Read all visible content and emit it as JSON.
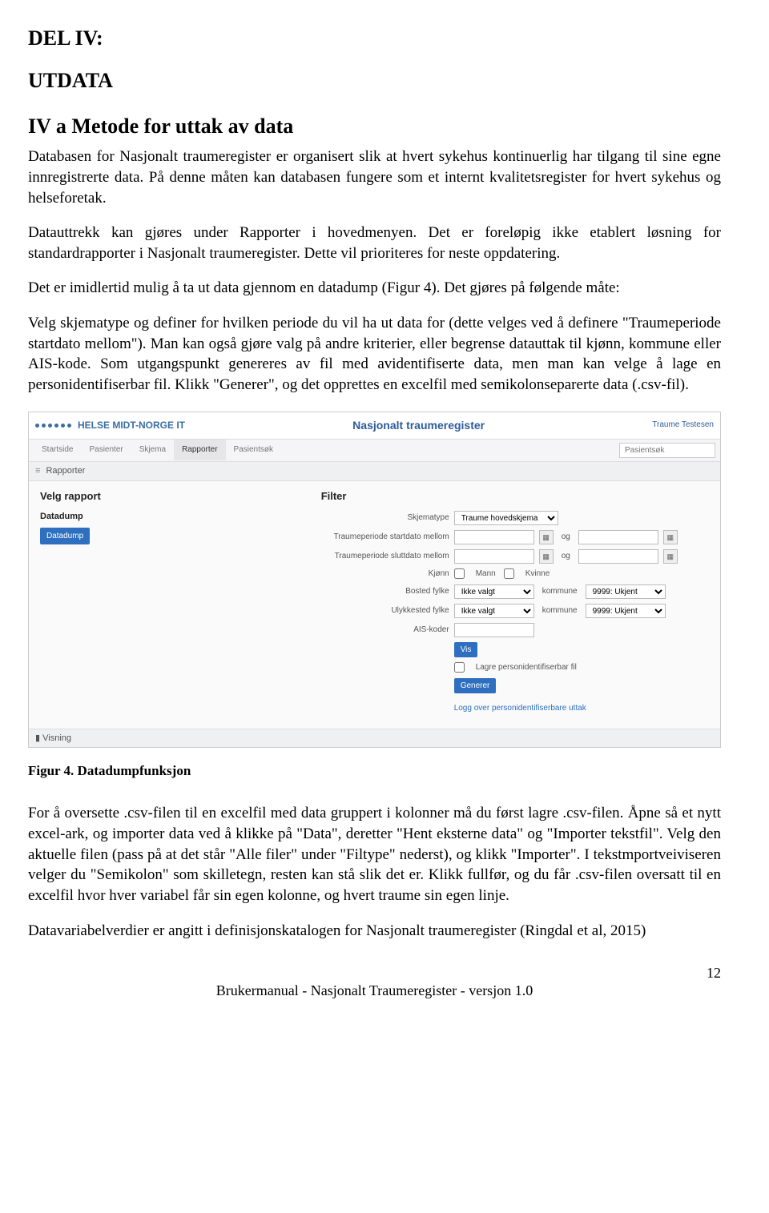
{
  "doc": {
    "section_num": "DEL IV:",
    "section_title": "UTDATA",
    "heading": "IV a  Metode for uttak av data",
    "para1": "Databasen for Nasjonalt traumeregister er organisert slik at hvert sykehus kontinuerlig har tilgang til sine egne innregistrerte data. På denne måten kan databasen fungere som et internt kvalitetsregister for hvert sykehus og helseforetak.",
    "para2": "Datauttrekk kan gjøres under Rapporter i hovedmenyen. Det er foreløpig ikke etablert løsning for standardrapporter i Nasjonalt traumeregister. Dette vil prioriteres for neste oppdatering.",
    "para3": "Det er imidlertid mulig å ta ut data gjennom en datadump (Figur 4). Det gjøres på følgende måte:",
    "para4": "Velg skjematype og definer for hvilken periode du vil ha ut data for (dette velges ved å definere \"Traumeperiode startdato mellom\"). Man kan også gjøre valg på andre kriterier, eller begrense datauttak til kjønn, kommune eller AIS-kode. Som utgangspunkt genereres av fil med avidentifiserte data, men man kan velge å lage en personidentifiserbar fil. Klikk \"Generer\", og det opprettes en excelfil med semikolonseparerte data (.csv-fil).",
    "figure_caption": "Figur 4. Datadumpfunksjon",
    "para5": "For å oversette .csv-filen til en excelfil med data gruppert i kolonner må du først lagre .csv-filen. Åpne så et nytt excel-ark, og importer data ved å klikke på \"Data\", deretter \"Hent eksterne data\" og \"Importer tekstfil\". Velg den aktuelle filen (pass på at det står \"Alle filer\" under \"Filtype\" nederst), og klikk \"Importer\". I tekstmportveiviseren velger du \"Semikolon\" som skilletegn, resten kan stå slik det er. Klikk fullfør, og du får .csv-filen oversatt til en excelfil hvor hver variabel får sin egen kolonne, og hvert traume sin egen linje.",
    "para6": "Datavariabelverdier er angitt i definisjonskatalogen for Nasjonalt traumeregister (Ringdal et al, 2015)",
    "footer": "Brukermanual - Nasjonalt Traumeregister - versjon 1.0",
    "page": "12"
  },
  "screenshot": {
    "brand": "HELSE MIDT-NORGE IT",
    "app_title": "Nasjonalt traumeregister",
    "user": "Traume Testesen",
    "nav": [
      "Startside",
      "Pasienter",
      "Skjema",
      "Rapporter",
      "Pasientsøk"
    ],
    "nav_active_index": 3,
    "search_placeholder": "Pasientsøk",
    "panel_reports": "Rapporter",
    "left_title": "Velg rapport",
    "datadump_sub": "Datadump",
    "datadump_btn": "Datadump",
    "right_title": "Filter",
    "labels": {
      "skjematype": "Skjematype",
      "start": "Traumeperiode startdato mellom",
      "slutt": "Traumeperiode sluttdato mellom",
      "kjonn": "Kjønn",
      "bosted": "Bosted fylke",
      "ulykke": "Ulykkested fylke",
      "ais": "AIS-koder",
      "kommune": "kommune",
      "mann": "Mann",
      "kvinne": "Kvinne",
      "og": "og"
    },
    "values": {
      "skjematype": "Traume hovedskjema",
      "fylke": "Ikke valgt",
      "kommune": "9999: Ukjent"
    },
    "vis_btn": "Vis",
    "lagre_check": "Lagre personidentifiserbar fil",
    "generer_btn": "Generer",
    "link": "Logg over personidentifiserbare uttak",
    "panel_visning": "Visning"
  }
}
